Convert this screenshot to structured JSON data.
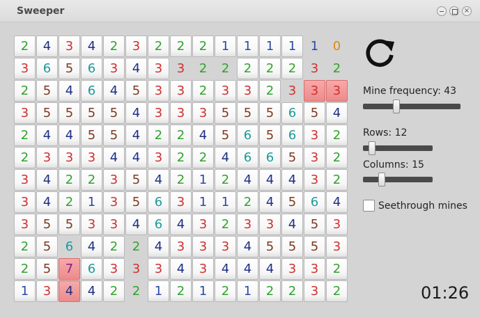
{
  "window": {
    "title": "Sweeper",
    "close_glyph": "×"
  },
  "board": {
    "rows": [
      [
        "2h",
        "4h",
        "3h",
        "4h",
        "2h",
        "3h",
        "2h",
        "2h",
        "2h",
        "1h",
        "1h",
        "1h",
        "1h",
        "1o",
        "0o"
      ],
      [
        "3h",
        "6h",
        "5h",
        "6h",
        "3h",
        "4h",
        "3h",
        "3o",
        "2o",
        "2o",
        "2h",
        "2h",
        "2h",
        "3o",
        "2o"
      ],
      [
        "2h",
        "5h",
        "4h",
        "6h",
        "4h",
        "5h",
        "3h",
        "3h",
        "2h",
        "3h",
        "3h",
        "2h",
        "3o",
        "3m",
        "3m"
      ],
      [
        "3h",
        "5h",
        "5h",
        "5h",
        "5h",
        "4h",
        "3h",
        "3h",
        "3h",
        "5h",
        "5h",
        "5h",
        "6h",
        "5h",
        "4h"
      ],
      [
        "2h",
        "4h",
        "4h",
        "5h",
        "5h",
        "4h",
        "2h",
        "2h",
        "4h",
        "5h",
        "6h",
        "5h",
        "6h",
        "3h",
        "2h"
      ],
      [
        "2h",
        "3h",
        "3h",
        "3h",
        "4h",
        "4h",
        "3h",
        "2h",
        "2h",
        "4h",
        "6h",
        "6h",
        "5h",
        "3h",
        "2h"
      ],
      [
        "3h",
        "4h",
        "2h",
        "2h",
        "3h",
        "5h",
        "4h",
        "2h",
        "1h",
        "2h",
        "4h",
        "4h",
        "4h",
        "3h",
        "2h"
      ],
      [
        "3h",
        "4h",
        "2h",
        "1h",
        "3h",
        "5h",
        "6h",
        "3h",
        "1h",
        "1h",
        "2h",
        "4h",
        "5h",
        "6h",
        "4h"
      ],
      [
        "3h",
        "5h",
        "5h",
        "3h",
        "3h",
        "4h",
        "6h",
        "4h",
        "3h",
        "2h",
        "3h",
        "3h",
        "4h",
        "5h",
        "3h"
      ],
      [
        "2h",
        "5h",
        "6o",
        "4h",
        "2h",
        "2o",
        "4h",
        "3h",
        "3h",
        "3h",
        "4h",
        "5h",
        "5h",
        "5h",
        "3h"
      ],
      [
        "2h",
        "5h",
        "7m",
        "6h",
        "3h",
        "3o",
        "3h",
        "4h",
        "3h",
        "4h",
        "4h",
        "4h",
        "3h",
        "3h",
        "2h"
      ],
      [
        "1h",
        "3h",
        "4m",
        "4h",
        "2h",
        "2o",
        "1h",
        "2h",
        "1h",
        "2h",
        "1h",
        "2h",
        "2h",
        "3h",
        "2h"
      ]
    ]
  },
  "controls": {
    "reload_icon": "reload-icon",
    "mine_frequency_label": "Mine frequency: 43",
    "mine_frequency_value": 43,
    "rows_label": "Rows: 12",
    "rows_value": 12,
    "columns_label": "Columns: 15",
    "columns_value": 15,
    "seethrough_label": "Seethrough mines",
    "seethrough_checked": false
  },
  "timer": "01:26"
}
